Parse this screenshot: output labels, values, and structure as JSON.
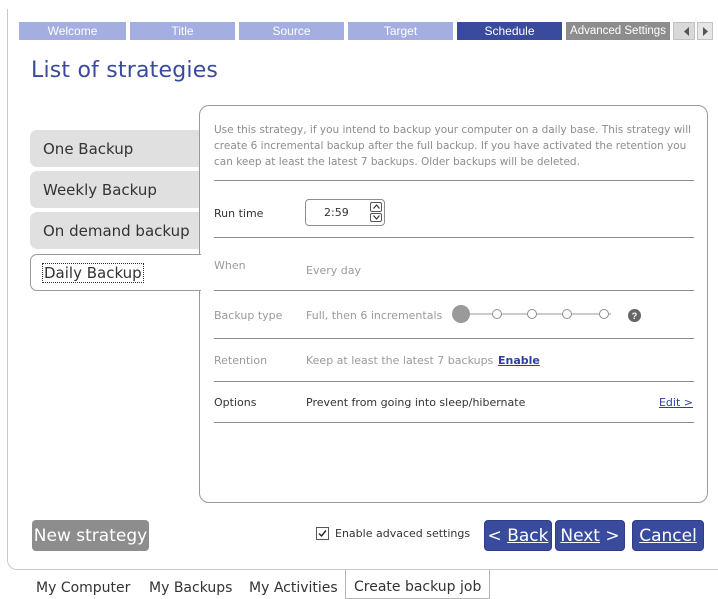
{
  "wizard_steps": [
    {
      "label": "Welcome",
      "active": false
    },
    {
      "label": "Title",
      "active": false
    },
    {
      "label": "Source",
      "active": false
    },
    {
      "label": "Target",
      "active": false
    },
    {
      "label": "Schedule",
      "active": true
    },
    {
      "label": "Advanced Settings",
      "active": false
    }
  ],
  "page_title": "List of strategies",
  "strategies": [
    {
      "label": "One Backup",
      "selected": false
    },
    {
      "label": "Weekly Backup",
      "selected": false
    },
    {
      "label": "On demand backup",
      "selected": false
    },
    {
      "label": "Daily Backup",
      "selected": true
    }
  ],
  "details": {
    "description": "Use this strategy, if you intend to backup your computer on a daily base. This strategy will create 6 incremental backup after the full backup. If you have activated the retention you can keep at least the latest 7 backups. Older backups will be deleted.",
    "run_time_label": "Run time",
    "run_time_value": "2:59",
    "when_label": "When",
    "when_value": "Every day",
    "backup_type_label": "Backup type",
    "backup_type_value": "Full, then 6 incrementals",
    "help_glyph": "?",
    "retention_label": "Retention",
    "retention_value": "Keep at least the latest 7 backups",
    "retention_link": "Enable",
    "options_label": "Options",
    "options_value": "Prevent from going into sleep/hibernate",
    "options_link": "Edit >"
  },
  "footer": {
    "new_strategy": "New strategy",
    "enable_advanced": "Enable advaced settings",
    "enable_advanced_checked": true,
    "back_prefix": "< ",
    "back_label": "Back",
    "next_label": "Next",
    "next_suffix": " >",
    "cancel_label": "Cancel"
  },
  "bottom_tabs": [
    {
      "label": "My Computer",
      "active": false
    },
    {
      "label": "My Backups",
      "active": false
    },
    {
      "label": "My Activities",
      "active": false
    },
    {
      "label": "Create backup job",
      "active": true
    }
  ],
  "colors": {
    "accent": "#3a4a9c",
    "step_inactive": "#a4aee0",
    "step_disabled": "#8d8d8d",
    "link": "#2b3fa0"
  },
  "icons": {
    "scroll_left": "triangle-left-icon",
    "scroll_right": "triangle-right-icon",
    "spin_up": "chevron-up-icon",
    "spin_down": "chevron-down-icon",
    "help": "help-icon",
    "check": "checkmark-icon"
  }
}
